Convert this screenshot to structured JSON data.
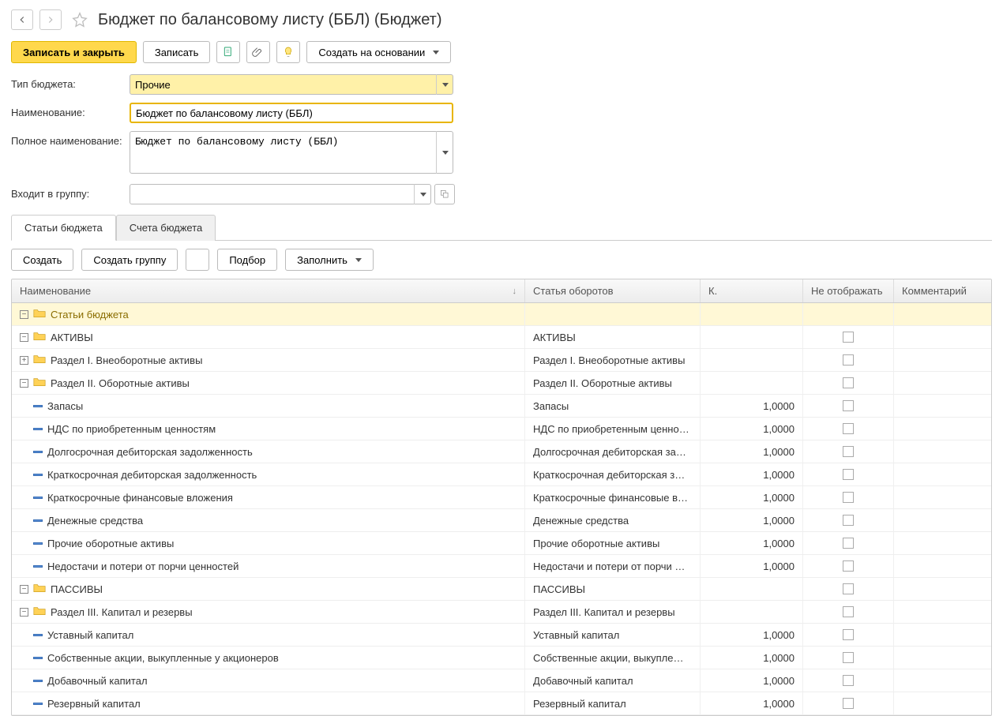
{
  "header": {
    "title": "Бюджет по балансовому листу (ББЛ) (Бюджет)"
  },
  "toolbar": {
    "save_close": "Записать и закрыть",
    "save": "Записать",
    "create_based_on": "Создать на основании"
  },
  "form": {
    "labels": {
      "budget_type": "Тип бюджета:",
      "name": "Наименование:",
      "full_name": "Полное наименование:",
      "in_group": "Входит в группу:"
    },
    "values": {
      "budget_type": "Прочие",
      "name": "Бюджет по балансовому листу (ББЛ)",
      "full_name": "Бюджет по балансовому листу (ББЛ)",
      "in_group": ""
    }
  },
  "tabs": {
    "items_tab": "Статьи бюджета",
    "accounts_tab": "Счета бюджета"
  },
  "grid_toolbar": {
    "create": "Создать",
    "create_group": "Создать группу",
    "select": "Подбор",
    "fill": "Заполнить"
  },
  "grid": {
    "headers": {
      "name": "Наименование",
      "turnover": "Статья оборотов",
      "k": "К.",
      "hide": "Не отображать",
      "comment": "Комментарий"
    },
    "rows": [
      {
        "level": 1,
        "type": "folder",
        "toggle": "-",
        "name": "Статьи бюджета",
        "turnover": "",
        "k": "",
        "root": true
      },
      {
        "level": 2,
        "type": "folder",
        "toggle": "-",
        "name": "АКТИВЫ",
        "turnover": "АКТИВЫ",
        "k": ""
      },
      {
        "level": 3,
        "type": "folder",
        "toggle": "+",
        "name": "Раздел I. Внеоборотные активы",
        "turnover": "Раздел I. Внеоборотные активы",
        "k": ""
      },
      {
        "level": 3,
        "type": "folder",
        "toggle": "-",
        "name": "Раздел II. Оборотные активы",
        "turnover": "Раздел II. Оборотные активы",
        "k": ""
      },
      {
        "level": 4,
        "type": "item",
        "name": "Запасы",
        "turnover": "Запасы",
        "k": "1,0000"
      },
      {
        "level": 4,
        "type": "item",
        "name": "НДС по приобретенным ценностям",
        "turnover": "НДС по приобретенным ценно…",
        "k": "1,0000"
      },
      {
        "level": 4,
        "type": "item",
        "name": "Долгосрочная дебиторская задолженность",
        "turnover": "Долгосрочная дебиторская за…",
        "k": "1,0000"
      },
      {
        "level": 4,
        "type": "item",
        "name": "Краткосрочная дебиторская задолженность",
        "turnover": "Краткосрочная дебиторская з…",
        "k": "1,0000"
      },
      {
        "level": 4,
        "type": "item",
        "name": "Краткосрочные финансовые вложения",
        "turnover": "Краткосрочные финансовые в…",
        "k": "1,0000"
      },
      {
        "level": 4,
        "type": "item",
        "name": "Денежные средства",
        "turnover": "Денежные средства",
        "k": "1,0000"
      },
      {
        "level": 4,
        "type": "item",
        "name": "Прочие оборотные активы",
        "turnover": "Прочие оборотные активы",
        "k": "1,0000"
      },
      {
        "level": 4,
        "type": "item",
        "name": "Недостачи и потери от порчи ценностей",
        "turnover": "Недостачи и потери от порчи …",
        "k": "1,0000"
      },
      {
        "level": 2,
        "type": "folder",
        "toggle": "-",
        "name": "ПАССИВЫ",
        "turnover": "ПАССИВЫ",
        "k": ""
      },
      {
        "level": 3,
        "type": "folder",
        "toggle": "-",
        "name": "Раздел III. Капитал и резервы",
        "turnover": "Раздел III. Капитал и резервы",
        "k": ""
      },
      {
        "level": 4,
        "type": "item",
        "name": "Уставный капитал",
        "turnover": "Уставный капитал",
        "k": "1,0000"
      },
      {
        "level": 4,
        "type": "item",
        "name": "Собственные акции, выкупленные у акционеров",
        "turnover": "Собственные акции, выкупле…",
        "k": "1,0000"
      },
      {
        "level": 4,
        "type": "item",
        "name": "Добавочный капитал",
        "turnover": "Добавочный капитал",
        "k": "1,0000"
      },
      {
        "level": 4,
        "type": "item",
        "name": "Резервный капитал",
        "turnover": "Резервный капитал",
        "k": "1,0000"
      }
    ]
  }
}
